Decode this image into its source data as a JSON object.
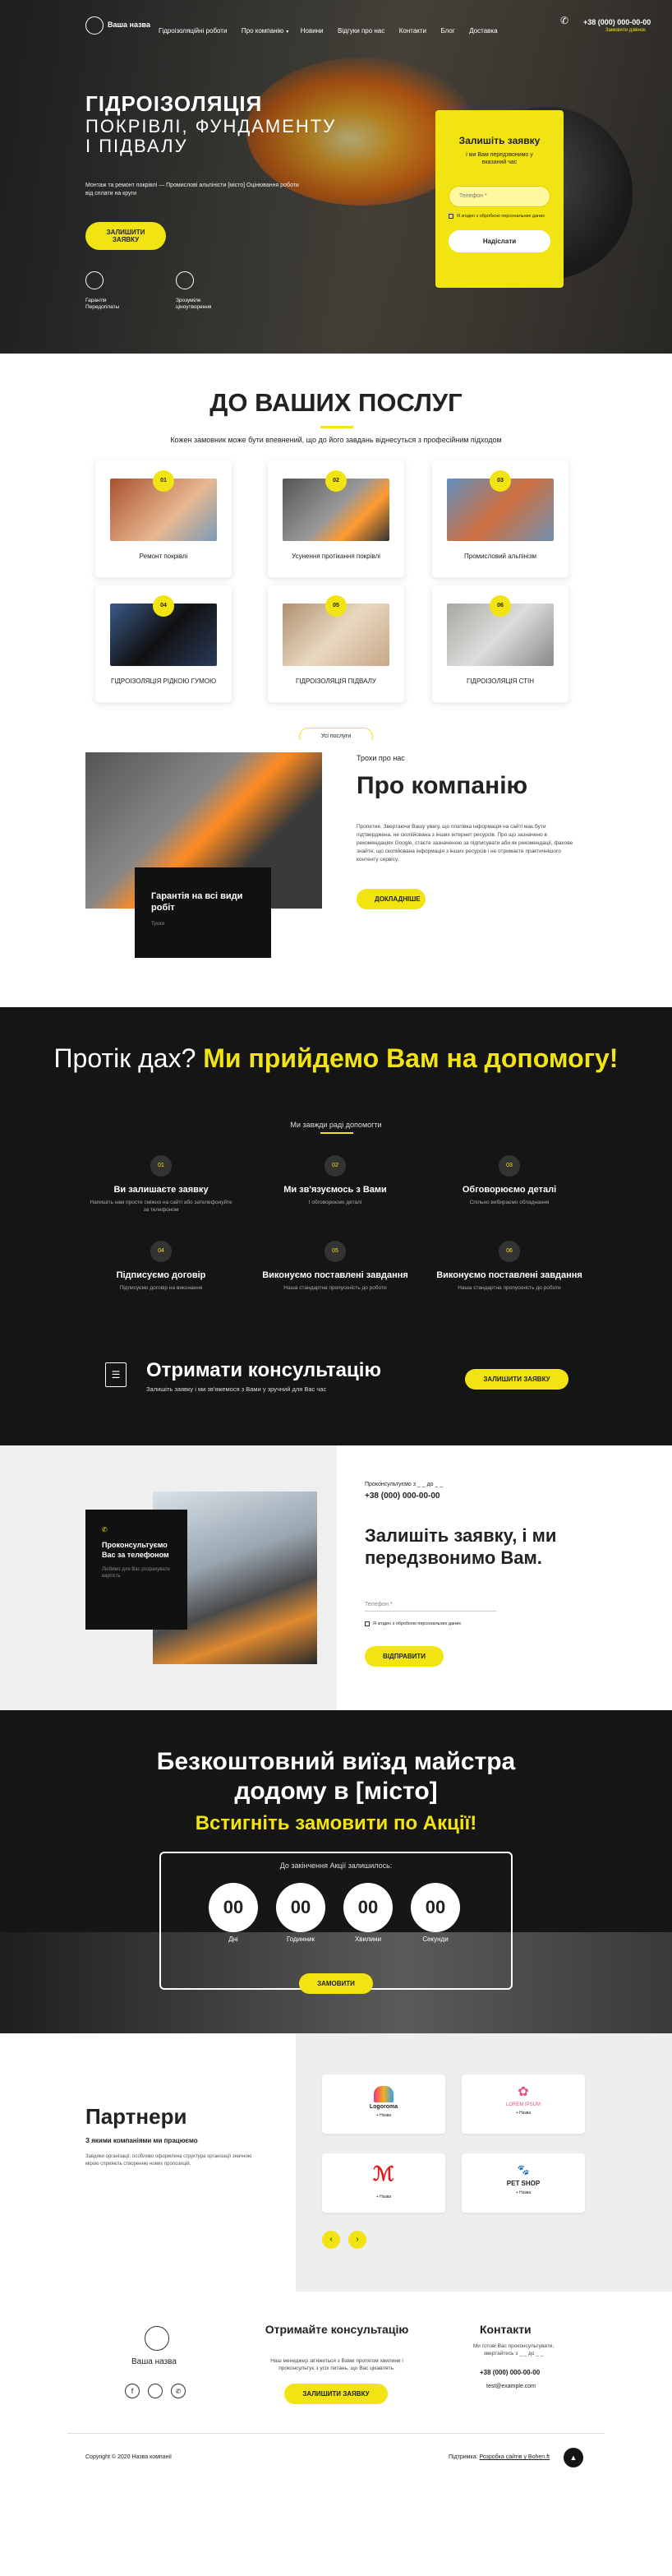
{
  "colors": {
    "accent": "#f2e312",
    "dark": "#151515"
  },
  "header": {
    "logo_text": "Ваша назва",
    "nav": [
      "Гідроізоляційні роботи",
      "Про компанію",
      "Новини",
      "Відгуки про нас",
      "Контакти",
      "Блог",
      "Доставка"
    ],
    "phone": "+38 (000) 000-00-00",
    "callback": "Замовити дзвінок"
  },
  "hero": {
    "title": "ГІДРОІЗОЛЯЦІЯ",
    "subtitle1": "ПОКРІВЛІ, ФУНДАМЕНТУ",
    "subtitle2": "І ПІДВАЛУ",
    "text1": "Монтаж та ремонт покрівлі — Промислові альпіністи [місто] Оцінювання роботи",
    "text2": "від сплати на круги",
    "cta": "ЗАЛИШИТИ ЗАЯВКУ",
    "feat1": "Гарантія",
    "feat1b": "Передоплаты",
    "feat2": "Зрозуміле",
    "feat2b": "ціноутворення"
  },
  "form": {
    "title": "Залишіть заявку",
    "subtitle": "і ми Вам передзвонимо у вказаний час",
    "phone_placeholder": "Телефон *",
    "consent": "Я згоден з обробкою персональних даних",
    "submit": "Надіслати"
  },
  "services": {
    "title": "ДО ВАШИХ ПОСЛУГ",
    "subtitle": "Кожен замовник може бути впевнений, що до його завдань віднесуться з професійним підходом",
    "items": [
      {
        "num": "01",
        "label": "Ремонт покрівлі"
      },
      {
        "num": "02",
        "label": "Усунення протікання покрівлі"
      },
      {
        "num": "03",
        "label": "Промисловий альпінізм"
      },
      {
        "num": "04",
        "label": "ГІДРОІЗОЛЯЦІЯ РІДКОЮ ГУМОЮ"
      },
      {
        "num": "05",
        "label": "ГІДРОІЗОЛЯЦІЯ ПІДВАЛУ"
      },
      {
        "num": "06",
        "label": "ГІДРОІЗОЛЯЦІЯ СТІН"
      }
    ],
    "all": "Усі послуги"
  },
  "about": {
    "kicker": "Трохи про нас",
    "title": "Про компанію",
    "text": "Пропетие. Звертаючи Вашу увагу, що платівка інформація на сайті має бути підтверджена, не скопійована з інших інтернет ресурсів. Про що зазначено в рекомендаціях Google, стаєте зазначеною за підписувати аби як рекомендації, фахове знайте, що скопійована інформація з інших ресурсів і не отримаєте практичнішого контенту сервісу.",
    "btn": "Докладніше",
    "guarantee": "Гарантія на всі види робіт",
    "guarantee_sub": "Трохи"
  },
  "help": {
    "title_white": "Протік дах?",
    "title_yellow": "Ми прийдемо Вам на допомогу!",
    "subtitle": "Ми завжди раді допомогти",
    "steps": [
      {
        "num": "01",
        "t": "Ви залишаєте заявку",
        "d": "Напишіть нам просте сміжно на сайті або зателефонуйте за телефоном"
      },
      {
        "num": "02",
        "t": "Ми зв'язуємось з Вами",
        "d": "І обговорюємо деталі"
      },
      {
        "num": "03",
        "t": "Обговорюємо деталі",
        "d": "Спільно вибираємо обладнання"
      },
      {
        "num": "04",
        "t": "Підписуємо договір",
        "d": "Підписуємо договір на виконання"
      },
      {
        "num": "05",
        "t": "Виконуємо поставлені завдання",
        "d": "Наша стандартна пропускність до роботи"
      },
      {
        "num": "06",
        "t": "Виконуємо поставлені завдання",
        "d": "Наша стандартна пропускність до роботи"
      }
    ],
    "consult_title": "Отримати консультацію",
    "consult_sub": "Залишіть заявку і ми зв'яжемося з Вами у зручний для Вас час",
    "consult_btn": "ЗАЛИШИТИ ЗАЯВКУ"
  },
  "callback": {
    "card_title": "Проконсультуємо Вас за телефоном",
    "card_sub": "Любимо для Вас розрахувати вартість",
    "card_icon": "phone-icon",
    "small": "Проконсультуємо з _ _ до _ _",
    "phone": "+38 (000) 000-00-00",
    "title": "Залишіть заявку, і ми передзвонимо Вам.",
    "phone_placeholder": "Телефон *",
    "consent": "Я згоден з обробкою персональних даних",
    "btn": "ВІДПРАВИТИ"
  },
  "promo": {
    "title1": "Безкоштовний виїзд майстра",
    "title2": "додому в [місто]",
    "title3": "Встигніть замовити по Акції!",
    "until": "До закінчення Акції залишилось:",
    "timer": [
      {
        "v": "00",
        "u": "Дні"
      },
      {
        "v": "00",
        "u": "Годинник"
      },
      {
        "v": "00",
        "u": "Хвилини"
      },
      {
        "v": "00",
        "u": "Секунди"
      }
    ],
    "btn": "ЗАМОВИТИ"
  },
  "partners": {
    "title": "Партнери",
    "subtitle": "З якими компаніями ми працюємо",
    "text": "Завдяки організації, особливо оформлена структура організації значною мірою сприяють створенню нових пропозицій.",
    "logos": [
      {
        "name": "Logoroma",
        "cap": "+ Назва"
      },
      {
        "name": "LOREM IPSUM",
        "cap": "+ Назва"
      },
      {
        "name": "",
        "cap": "+ Назва"
      },
      {
        "name": "PET SHOP",
        "cap": "+ Назва"
      }
    ]
  },
  "footer": {
    "logo_text": "Ваша назва",
    "consult_title": "Отримайте консультацію",
    "consult_text": "Наш менеджер зв'яжеться з Вами протягом хвилини і проконсультує з усіх питань, що Вас цікавлять.",
    "consult_btn": "ЗАЛИШИТИ ЗАЯВКУ",
    "contacts_title": "Контакти",
    "contacts_text": "Ми готові Вас проконсультувати, звертайтесь з _ _ до _ _",
    "phone": "+38 (000) 000-00-00",
    "email": "test@example.com",
    "copyright": "Copyright © 2020 Назва компанії",
    "dev": "Розробка сайтів у Bohen.ft",
    "dev_prefix": "Підтримка:"
  }
}
